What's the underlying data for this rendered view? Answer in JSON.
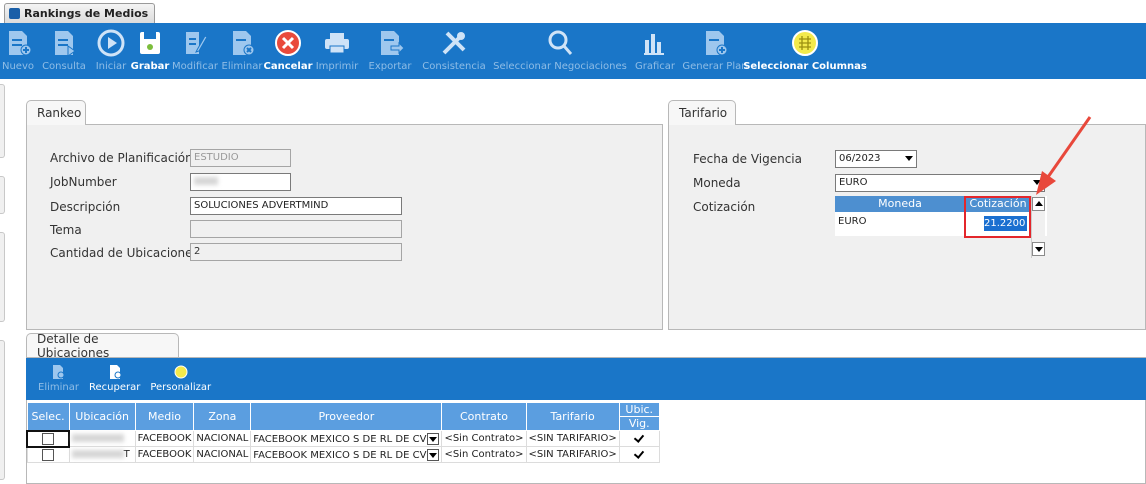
{
  "window_tab": {
    "title": "Rankings de Medios"
  },
  "toolbar": {
    "buttons": [
      {
        "id": "nuevo",
        "label": "Nuevo",
        "active": false
      },
      {
        "id": "consulta",
        "label": "Consulta",
        "active": false
      },
      {
        "id": "iniciar",
        "label": "Iniciar",
        "active": false
      },
      {
        "id": "grabar",
        "label": "Grabar",
        "active": true
      },
      {
        "id": "modificar",
        "label": "Modificar",
        "active": false
      },
      {
        "id": "eliminar",
        "label": "Eliminar",
        "active": false
      },
      {
        "id": "cancelar",
        "label": "Cancelar",
        "active": true
      },
      {
        "id": "imprimir",
        "label": "Imprimir",
        "active": false
      },
      {
        "id": "exportar",
        "label": "Exportar",
        "active": false
      },
      {
        "id": "consistencia",
        "label": "Consistencia",
        "active": false
      },
      {
        "id": "seleccionar-negociaciones",
        "label": "Seleccionar Negociaciones",
        "active": false
      },
      {
        "id": "graficar",
        "label": "Graficar",
        "active": false
      },
      {
        "id": "generar-plan",
        "label": "Generar Plan",
        "active": false
      },
      {
        "id": "seleccionar-columnas",
        "label": "Seleccionar Columnas",
        "active": true
      }
    ]
  },
  "rankeo": {
    "tab_label": "Rankeo",
    "fields": {
      "archivo_label": "Archivo de Planificación",
      "archivo_value": "ESTUDIO",
      "jobnumber_label": "JobNumber",
      "descripcion_label": "Descripción",
      "descripcion_value": "SOLUCIONES ADVERTMIND",
      "tema_label": "Tema",
      "tema_value": "",
      "cantidad_label": "Cantidad de Ubicaciones",
      "cantidad_value": "2"
    }
  },
  "tarifario": {
    "tab_label": "Tarifario",
    "fecha_label": "Fecha de Vigencia",
    "fecha_value": "06/2023",
    "moneda_label": "Moneda",
    "moneda_value": "EURO",
    "cotizacion_label": "Cotización",
    "grid": {
      "col_moneda": "Moneda",
      "col_cotizacion": "Cotización",
      "row_moneda": "EURO",
      "row_cotizacion": "21.2200"
    }
  },
  "detalle": {
    "tab_label": "Detalle de Ubicaciones",
    "toolbar": {
      "eliminar": "Eliminar",
      "recuperar": "Recuperar",
      "personalizar": "Personalizar"
    },
    "columns": {
      "selec": "Selec.",
      "ubicacion": "Ubicación",
      "medio": "Medio",
      "zona": "Zona",
      "proveedor": "Proveedor",
      "contrato": "Contrato",
      "tarifario": "Tarifario",
      "ubic_top": "Ubic.",
      "ubic_bottom": "Vig."
    },
    "rows": [
      {
        "medio": "FACEBOOK",
        "zona": "NACIONAL",
        "proveedor": "FACEBOOK MEXICO S DE RL DE CV",
        "contrato": "<Sin Contrato>",
        "tarifario": "<SIN TARIFARIO>",
        "ubic_ending": ""
      },
      {
        "medio": "FACEBOOK",
        "zona": "NACIONAL",
        "proveedor": "FACEBOOK MEXICO S DE RL DE CV",
        "contrato": "<Sin Contrato>",
        "tarifario": "<SIN TARIFARIO>",
        "ubic_ending": "T"
      }
    ]
  },
  "colors": {
    "toolbar_bg": "#1a76c8",
    "table_header": "#5b9ee0",
    "highlight": "#e3262b"
  }
}
